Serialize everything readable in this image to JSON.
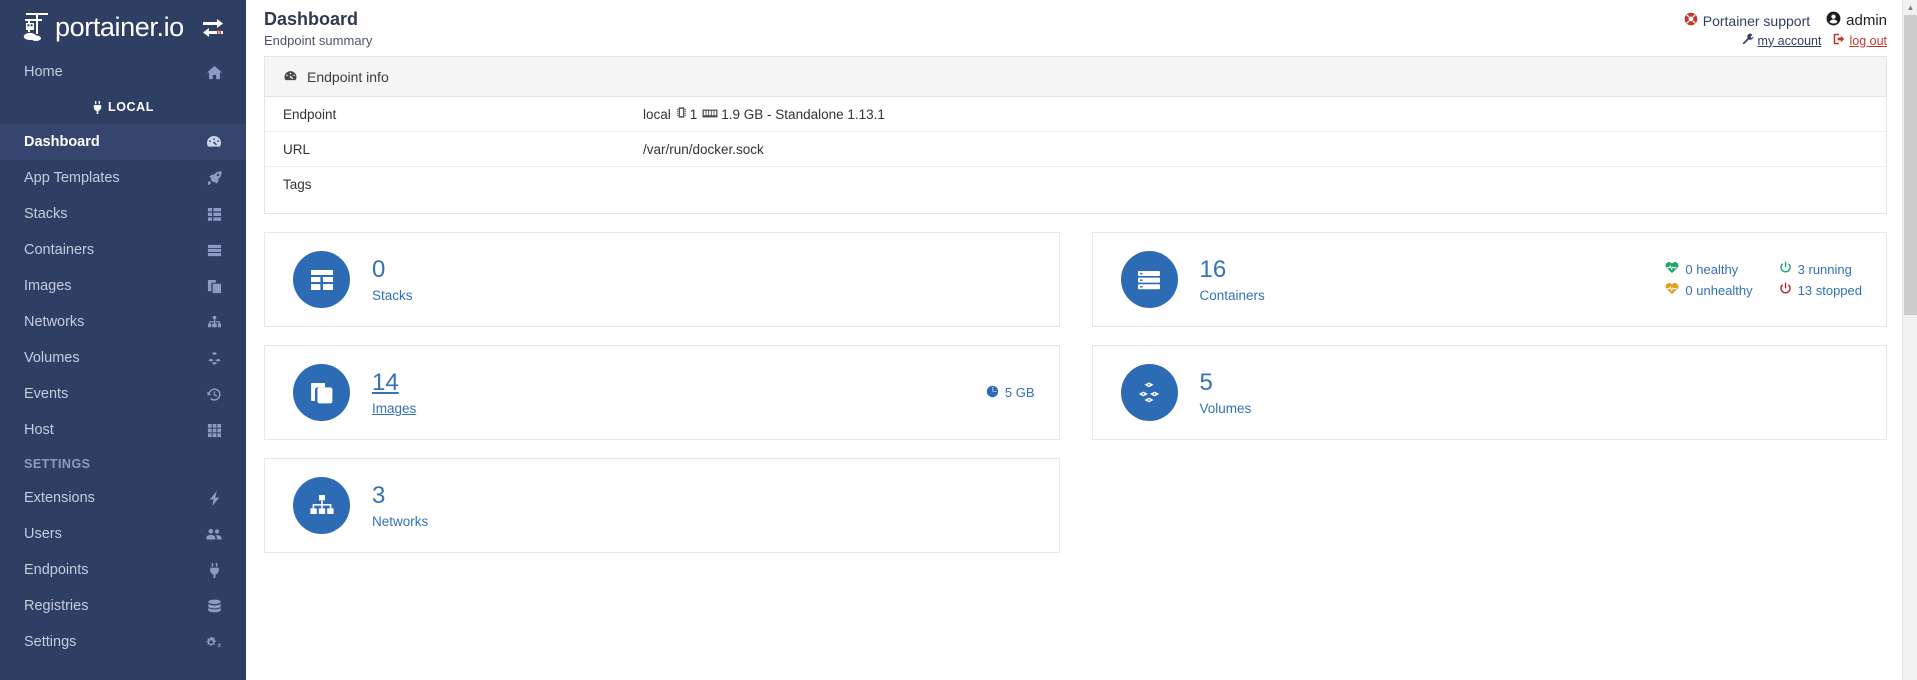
{
  "brand": {
    "name": "portainer.io",
    "logo_icon": "portainer-crane-icon",
    "switch_icon": "endpoint-switch-icon"
  },
  "sidebar": {
    "home": {
      "label": "Home",
      "icon": "home-icon"
    },
    "section_label": "LOCAL",
    "section_icon": "plug-icon",
    "items": [
      {
        "label": "Dashboard",
        "icon": "dashboard-gauge-icon",
        "active": true
      },
      {
        "label": "App Templates",
        "icon": "rocket-icon",
        "active": false
      },
      {
        "label": "Stacks",
        "icon": "stacks-grid-icon",
        "active": false
      },
      {
        "label": "Containers",
        "icon": "containers-list-icon",
        "active": false
      },
      {
        "label": "Images",
        "icon": "images-copy-icon",
        "active": false
      },
      {
        "label": "Networks",
        "icon": "networks-sitemap-icon",
        "active": false
      },
      {
        "label": "Volumes",
        "icon": "volumes-cubes-icon",
        "active": false
      },
      {
        "label": "Events",
        "icon": "history-clock-icon",
        "active": false
      },
      {
        "label": "Host",
        "icon": "host-th-icon",
        "active": false
      }
    ],
    "settings_label": "SETTINGS",
    "settings_items": [
      {
        "label": "Extensions",
        "icon": "bolt-icon"
      },
      {
        "label": "Users",
        "icon": "users-icon"
      },
      {
        "label": "Endpoints",
        "icon": "plug-icon"
      },
      {
        "label": "Registries",
        "icon": "database-icon"
      },
      {
        "label": "Settings",
        "icon": "cogs-icon"
      }
    ]
  },
  "header": {
    "title": "Dashboard",
    "subtitle": "Endpoint summary",
    "support_label": "Portainer support",
    "support_icon": "life-ring-icon",
    "user_label": "admin",
    "user_icon": "user-circle-icon",
    "my_account_label": "my account",
    "my_account_icon": "wrench-icon",
    "logout_label": "log out",
    "logout_icon": "sign-out-icon"
  },
  "endpoint_panel": {
    "title": "Endpoint info",
    "title_icon": "tachometer-icon",
    "rows": [
      {
        "label": "Endpoint",
        "value": "local",
        "cpu_icon": "microchip-icon",
        "cpu_value": "1",
        "memory_icon": "memory-icon",
        "memory_value": "1.9 GB - Standalone 1.13.1"
      },
      {
        "label": "URL",
        "value": "/var/run/docker.sock"
      },
      {
        "label": "Tags",
        "value": ""
      }
    ]
  },
  "cards": {
    "stacks": {
      "count": "0",
      "label": "Stacks",
      "icon": "stacks-grid-icon"
    },
    "containers": {
      "count": "16",
      "label": "Containers",
      "icon": "containers-server-icon",
      "health": [
        {
          "label": "0 healthy",
          "icon": "heartbeat-icon",
          "color": "#23a66a"
        },
        {
          "label": "3 running",
          "icon": "power-icon",
          "color": "#1f9d76"
        },
        {
          "label": "0 unhealthy",
          "icon": "heartbeat-icon",
          "color": "#e0a021"
        },
        {
          "label": "13 stopped",
          "icon": "power-icon",
          "color": "#b52626"
        }
      ]
    },
    "images": {
      "count": "14",
      "label": "Images",
      "icon": "images-copy-icon",
      "size_label": "5 GB",
      "size_icon": "pie-chart-icon"
    },
    "volumes": {
      "count": "5",
      "label": "Volumes",
      "icon": "volumes-cubes-icon"
    },
    "networks": {
      "count": "3",
      "label": "Networks",
      "icon": "networks-sitemap-icon"
    }
  },
  "colors": {
    "sidebar_bg": "#2f3e63",
    "sidebar_active": "#35456d",
    "accent_blue": "#2d6cb5",
    "link_blue": "#3272b5",
    "danger_red": "#c0392b"
  }
}
